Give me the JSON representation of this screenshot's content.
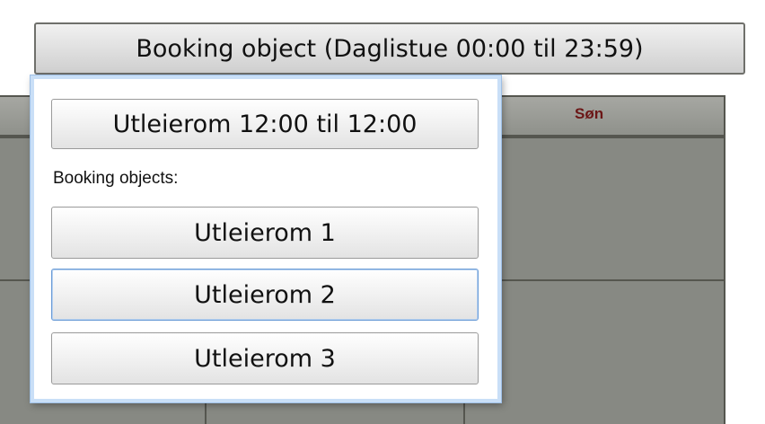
{
  "booking_button": {
    "label": "Booking object (Daglistue 00:00 til 23:59)"
  },
  "calendar": {
    "visible_day_header": "Søn"
  },
  "popup": {
    "current_label": "Utleierom 12:00 til 12:00",
    "section_label": "Booking objects:",
    "options": [
      "Utleierom 1",
      "Utleierom 2",
      "Utleierom 3"
    ],
    "focused_option": "Utleierom 2"
  },
  "colors": {
    "popup_border": "#c9dff7",
    "day_header_text": "#6b1616",
    "calendar_bg": "#878983"
  }
}
